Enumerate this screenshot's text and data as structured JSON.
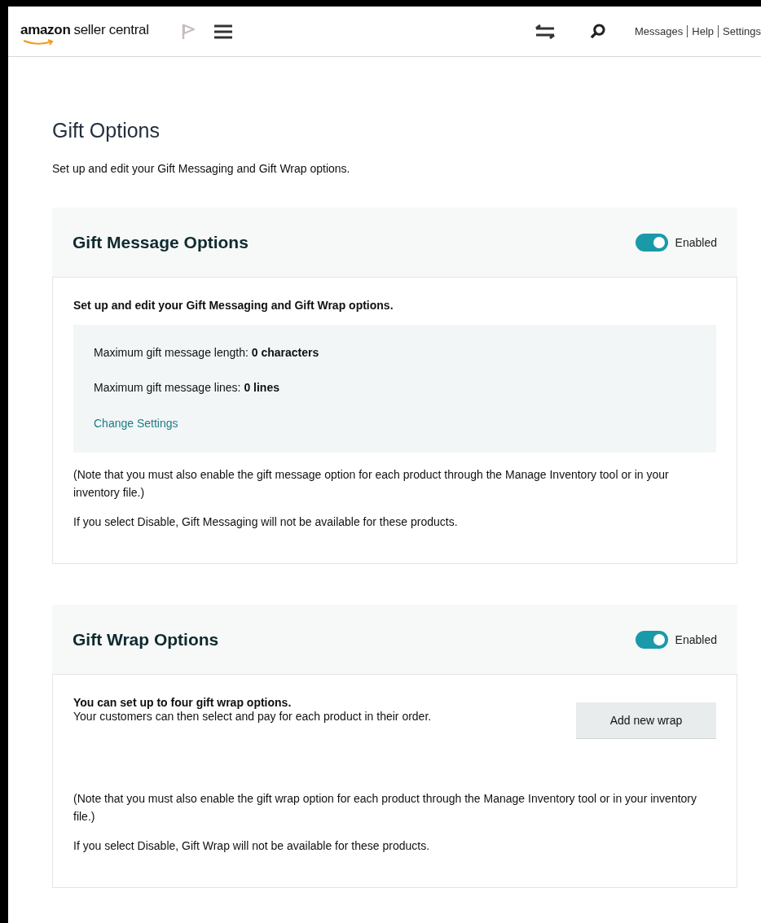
{
  "header": {
    "logo": {
      "brand": "amazon",
      "product": "seller central"
    },
    "links": [
      {
        "label": "Messages"
      },
      {
        "label": "Help"
      },
      {
        "label": "Settings"
      }
    ]
  },
  "page": {
    "title": "Gift Options",
    "subtitle": "Set up and edit your Gift Messaging and Gift Wrap options."
  },
  "sections": [
    {
      "kind": "message",
      "title": "Gift Message Options",
      "toggle": {
        "on": true,
        "label": "Enabled"
      },
      "intro": "Set up and edit your Gift Messaging and Gift Wrap options.",
      "settings": [
        {
          "label": "Maximum gift message length:",
          "value": "0 characters"
        },
        {
          "label": "Maximum gift message lines:",
          "value": "0 lines"
        }
      ],
      "settings_link": "Change Settings",
      "notes": [
        "(Note that you must also enable the gift message option for each product through the Manage Inventory tool or in your inventory file.)",
        "If you select Disable, Gift Messaging will not be available for these products."
      ]
    },
    {
      "kind": "wrap",
      "title": "Gift Wrap Options",
      "toggle": {
        "on": true,
        "label": "Enabled"
      },
      "intro": "You can set up to four gift wrap options.",
      "intro_detail": "Your customers can then select and pay for each product in their order.",
      "button": "Add new wrap",
      "notes": [
        "(Note that you must also enable the gift wrap option for each product through the Manage Inventory tool or in your inventory file.)",
        "If you select Disable, Gift Wrap will not be available for these products."
      ]
    }
  ]
}
